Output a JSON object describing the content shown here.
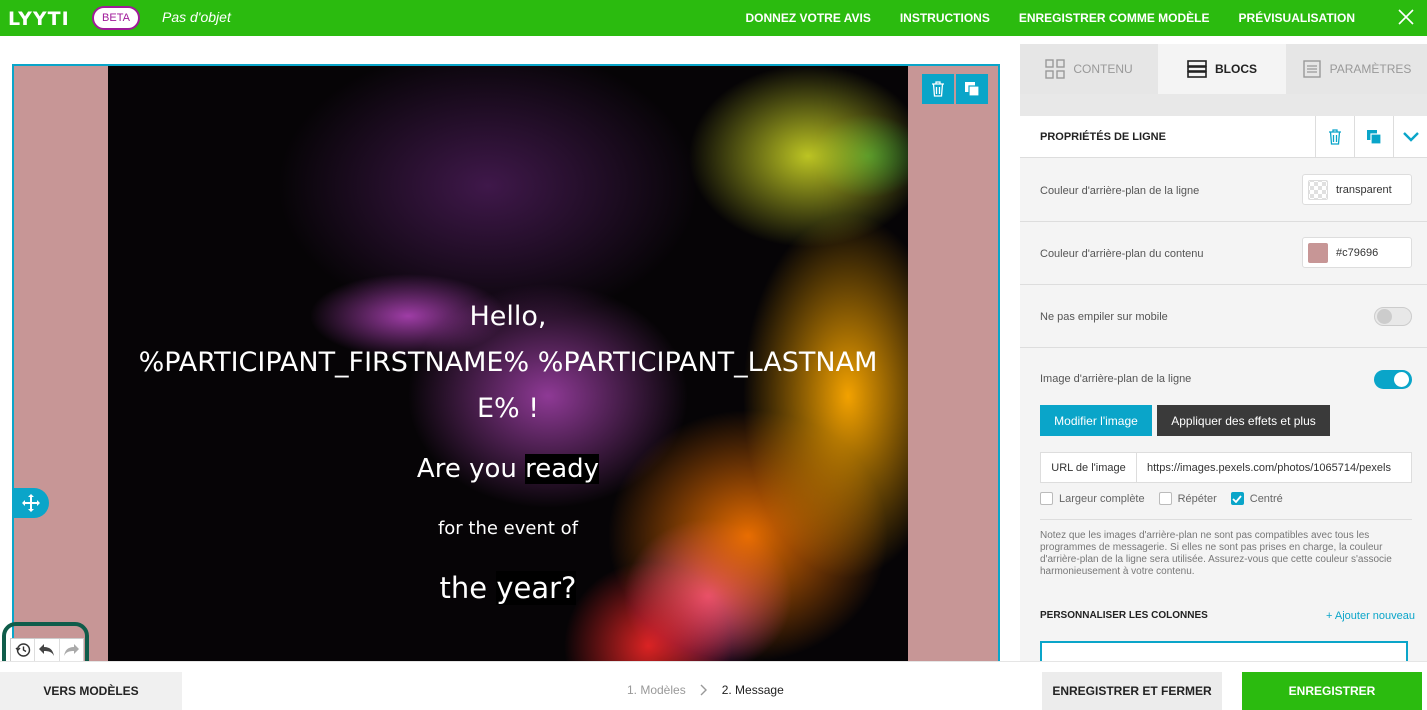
{
  "app": {
    "logo": "LYYTI",
    "badge": "BETA",
    "subject": "Pas d'objet"
  },
  "topnav": {
    "feedback": "DONNEZ VOTRE AVIS",
    "instructions": "INSTRUCTIONS",
    "save_template": "ENREGISTRER COMME MODÈLE",
    "preview": "PRÉVISUALISATION"
  },
  "canvas": {
    "hello_line1": "Hello,",
    "hello_line2": "%PARTICIPANT_FIRSTNAME% %PARTICIPANT_LASTNAM",
    "hello_line3": "E% !",
    "ready_prefix": "Are you ",
    "ready_highlight": "ready",
    "event_line": "for the event of",
    "year_prefix": "the ",
    "year_highlight": "year?"
  },
  "panel": {
    "tabs": {
      "content": "CONTENU",
      "blocks": "BLOCS",
      "settings": "PARAMÈTRES"
    },
    "section_title": "PROPRIÉTÉS DE LIGNE",
    "row_bg_label": "Couleur d'arrière-plan de la ligne",
    "row_bg_value": "transparent",
    "content_bg_label": "Couleur d'arrière-plan du contenu",
    "content_bg_value": "#c79696",
    "no_stack_label": "Ne pas empiler sur mobile",
    "no_stack_on": false,
    "bg_image_label": "Image d'arrière-plan de la ligne",
    "bg_image_on": true,
    "modify_image": "Modifier l'image",
    "apply_effects": "Appliquer des effets et plus",
    "url_label": "URL de l'image",
    "url_value": "https://images.pexels.com/photos/1065714/pexels",
    "full_width": "Largeur complète",
    "full_width_checked": false,
    "repeat": "Répéter",
    "repeat_checked": false,
    "centered": "Centré",
    "centered_checked": true,
    "note": "Notez que les images d'arrière-plan ne sont pas compatibles avec tous les programmes de messagerie. Si elles ne sont pas prises en charge, la couleur d'arrière-plan de la ligne sera utilisée. Assurez-vous que cette couleur s'associe harmonieusement à votre contenu.",
    "columns_title": "PERSONNALISER LES COLONNES",
    "add_new": "Ajouter nouveau"
  },
  "bottom": {
    "to_models": "VERS MODÈLES",
    "step1": "1. Modèles",
    "step2": "2. Message",
    "save_close": "ENREGISTRER ET FERMER",
    "save": "ENREGISTRER"
  },
  "colors": {
    "brand_green": "#2bbb0f",
    "accent_blue": "#0aa5c9",
    "content_bg": "#c79696",
    "beta_purple": "#a01a9a"
  },
  "icons": {
    "close": "close-icon",
    "trash": "trash-icon",
    "duplicate": "duplicate-icon",
    "move": "move-icon",
    "history": "history-icon",
    "undo": "undo-icon",
    "redo": "redo-icon",
    "grid": "grid-icon",
    "blocks": "blocks-icon",
    "settings": "settings-icon",
    "chevron": "chevron-down-icon"
  }
}
